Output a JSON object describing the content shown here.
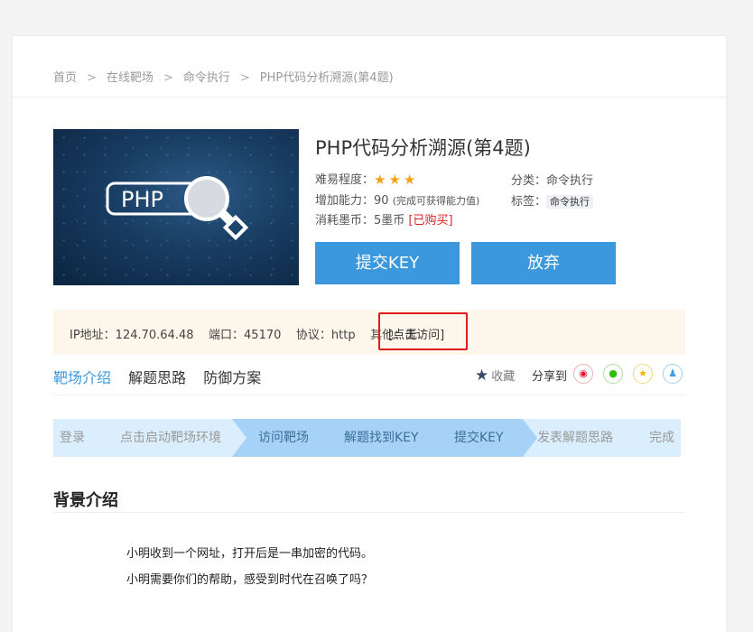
{
  "breadcrumb": [
    "首页",
    "在线靶场",
    "命令执行",
    "PHP代码分析溯源(第4题)"
  ],
  "breadcrumb_sep": ">",
  "thumbnail": {
    "text": "PHP"
  },
  "challenge": {
    "title": "PHP代码分析溯源(第4题)",
    "difficulty_label": "难易程度：",
    "difficulty_stars": 3,
    "gain_label": "增加能力：90",
    "gain_note": "(完成可获得能力值)",
    "cost_label": "消耗墨币：5墨币",
    "purchased": "[已购买]",
    "category_label": "分类：命令执行",
    "tag_label": "标签：",
    "tag": "命令执行"
  },
  "buttons": {
    "submit": "提交KEY",
    "giveup": "放弃"
  },
  "info": {
    "text": "IP地址：124.70.64.48    端口：45170    协议：http    其他：无",
    "visit": "[点击访问]"
  },
  "tabs": [
    "靶场介绍",
    "解题思路",
    "防御方案"
  ],
  "actions": {
    "collect": "收藏",
    "share": "分享到"
  },
  "steps": [
    "登录",
    "点击启动靶场环境",
    "访问靶场",
    "解题找到KEY",
    "提交KEY",
    "发表解题思路",
    "完成"
  ],
  "section": {
    "title": "背景介绍",
    "lines": [
      "小明收到一个网址，打开后是一串加密的代码。",
      "小明需要你们的帮助，感受到时代在召唤了吗？"
    ]
  },
  "colors": {
    "accent": "#3b98dd",
    "star": "#f7a11b",
    "highlight_box": "#e01b1b"
  }
}
